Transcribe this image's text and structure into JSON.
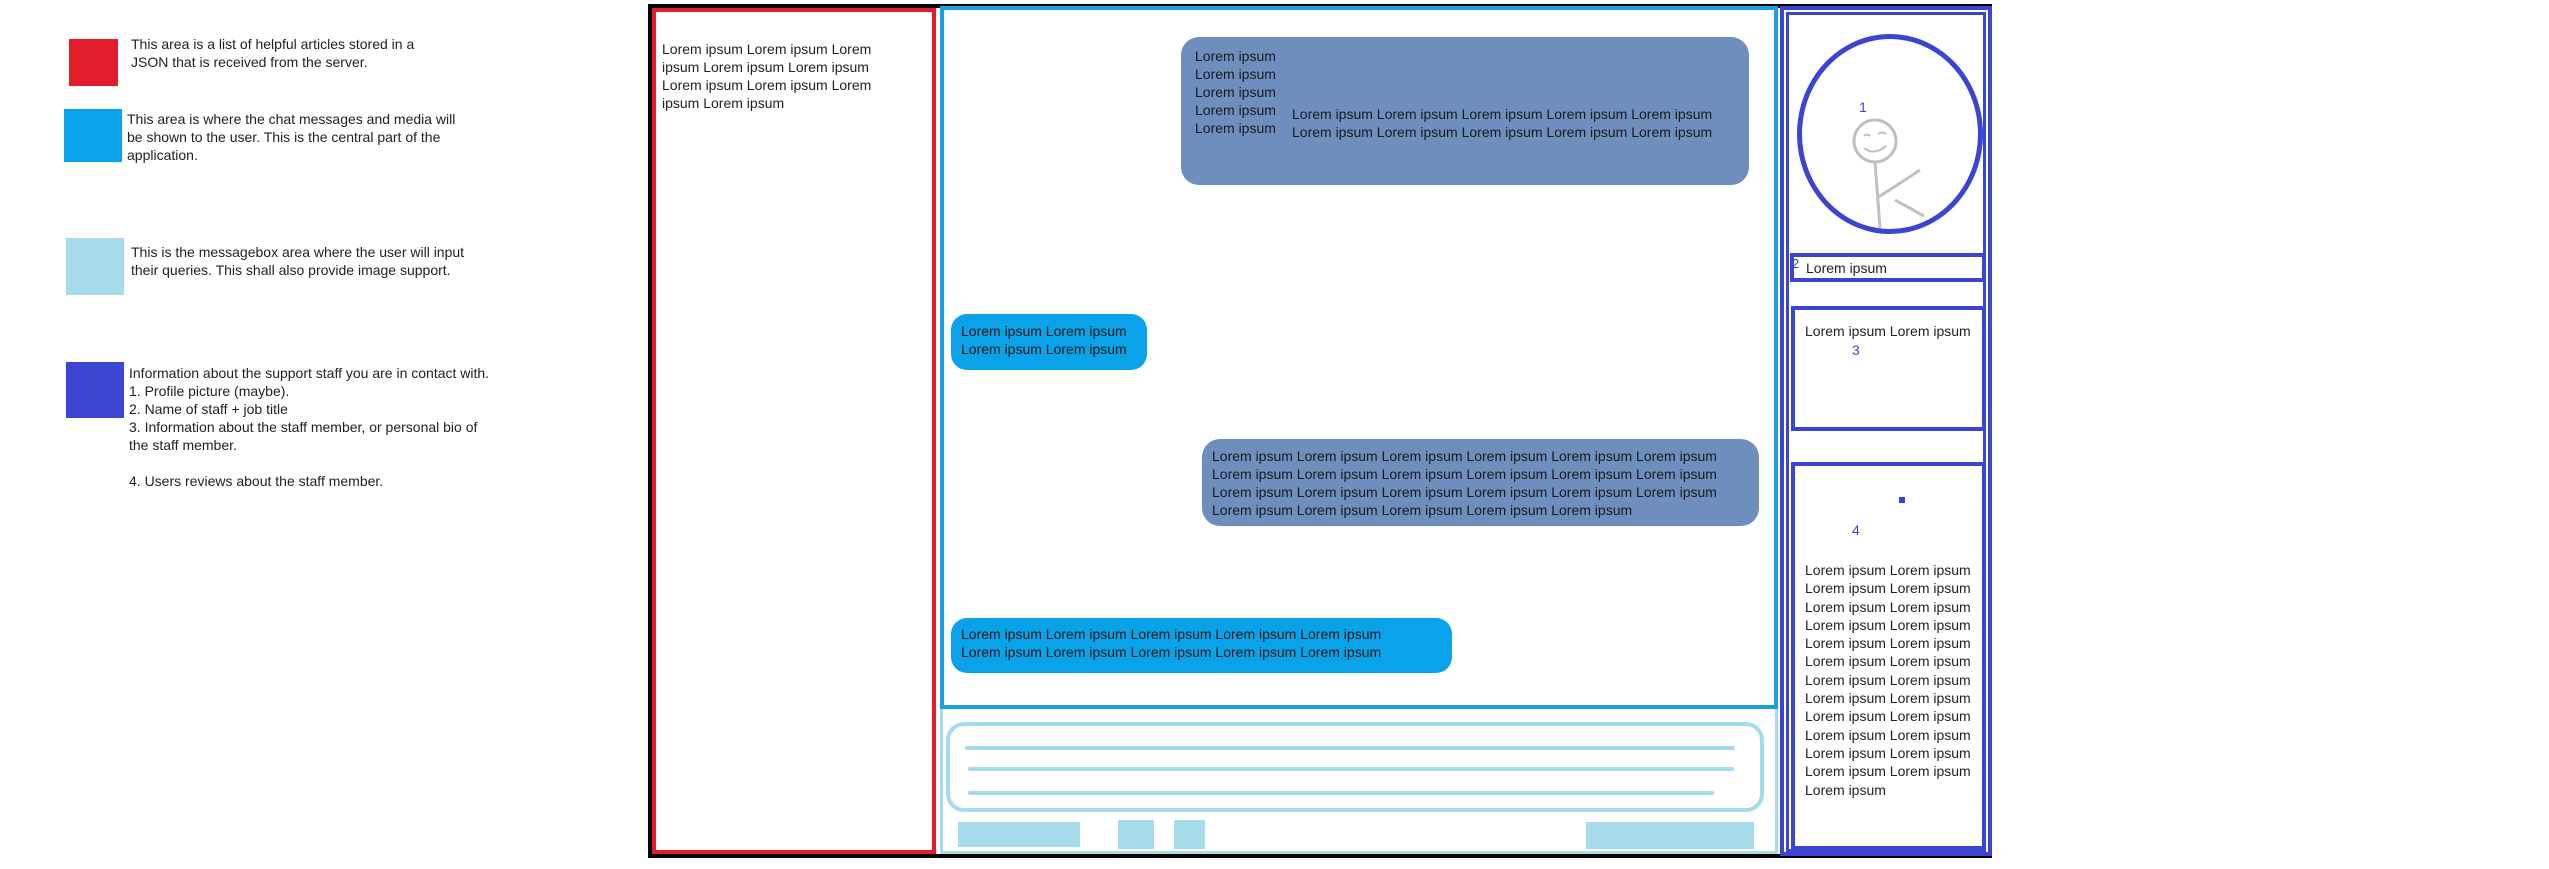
{
  "legend": {
    "items": [
      {
        "color": "#e21c2a",
        "text": "This area is a list of helpful articles stored in a\nJSON that is received from the server."
      },
      {
        "color": "#0aa2e8",
        "text": "This area is where the chat messages and media will\nbe shown to the user. This is the central part of the\napplication."
      },
      {
        "color": "#a5dbeb",
        "text": "This is the messagebox area where the user will input\ntheir queries. This shall also provide image support."
      },
      {
        "color": "#3b45d1",
        "text": "Information about the support staff you are in contact with.\n1. Profile picture (maybe).\n2. Name of staff + job title\n3. Information about the staff member, or personal bio of\nthe staff member.\n\n4. Users reviews about the staff member."
      }
    ]
  },
  "sidebar": {
    "text": "Lorem ipsum Lorem ipsum Lorem ipsum Lorem ipsum Lorem ipsum Lorem ipsum Lorem ipsum Lorem ipsum Lorem ipsum"
  },
  "chat": {
    "msg1_col": [
      "Lorem ipsum",
      "Lorem ipsum",
      "Lorem ipsum",
      "Lorem ipsum",
      "Lorem ipsum"
    ],
    "msg1_side": [
      "Lorem ipsum Lorem ipsum Lorem ipsum Lorem ipsum Lorem ipsum",
      "Lorem ipsum Lorem ipsum Lorem ipsum Lorem ipsum Lorem ipsum"
    ],
    "msg2": [
      "Lorem ipsum Lorem ipsum",
      "Lorem ipsum Lorem ipsum"
    ],
    "msg3": [
      "Lorem ipsum Lorem ipsum Lorem ipsum Lorem ipsum Lorem ipsum Lorem ipsum",
      "Lorem ipsum Lorem ipsum Lorem ipsum Lorem ipsum Lorem ipsum Lorem ipsum",
      "Lorem ipsum Lorem ipsum Lorem ipsum Lorem ipsum Lorem ipsum Lorem ipsum",
      "Lorem ipsum Lorem ipsum Lorem ipsum Lorem ipsum Lorem ipsum"
    ],
    "msg4": [
      "Lorem ipsum Lorem ipsum Lorem ipsum Lorem ipsum Lorem ipsum",
      "Lorem ipsum Lorem ipsum Lorem ipsum Lorem ipsum Lorem ipsum"
    ]
  },
  "staff": {
    "num1": "1",
    "num2": "2",
    "num3": "3",
    "num4": "4",
    "name": "Lorem ipsum",
    "bio": "Lorem ipsum Lorem ipsum",
    "reviews": [
      "Lorem ipsum Lorem ipsum",
      "Lorem ipsum Lorem ipsum",
      "Lorem ipsum Lorem ipsum",
      "Lorem ipsum Lorem ipsum",
      "Lorem ipsum Lorem ipsum",
      "Lorem ipsum Lorem ipsum",
      "Lorem ipsum Lorem ipsum",
      "Lorem ipsum Lorem ipsum",
      "Lorem ipsum Lorem ipsum",
      "Lorem ipsum Lorem ipsum",
      "Lorem ipsum Lorem ipsum",
      "Lorem ipsum Lorem ipsum",
      "Lorem ipsum"
    ]
  }
}
